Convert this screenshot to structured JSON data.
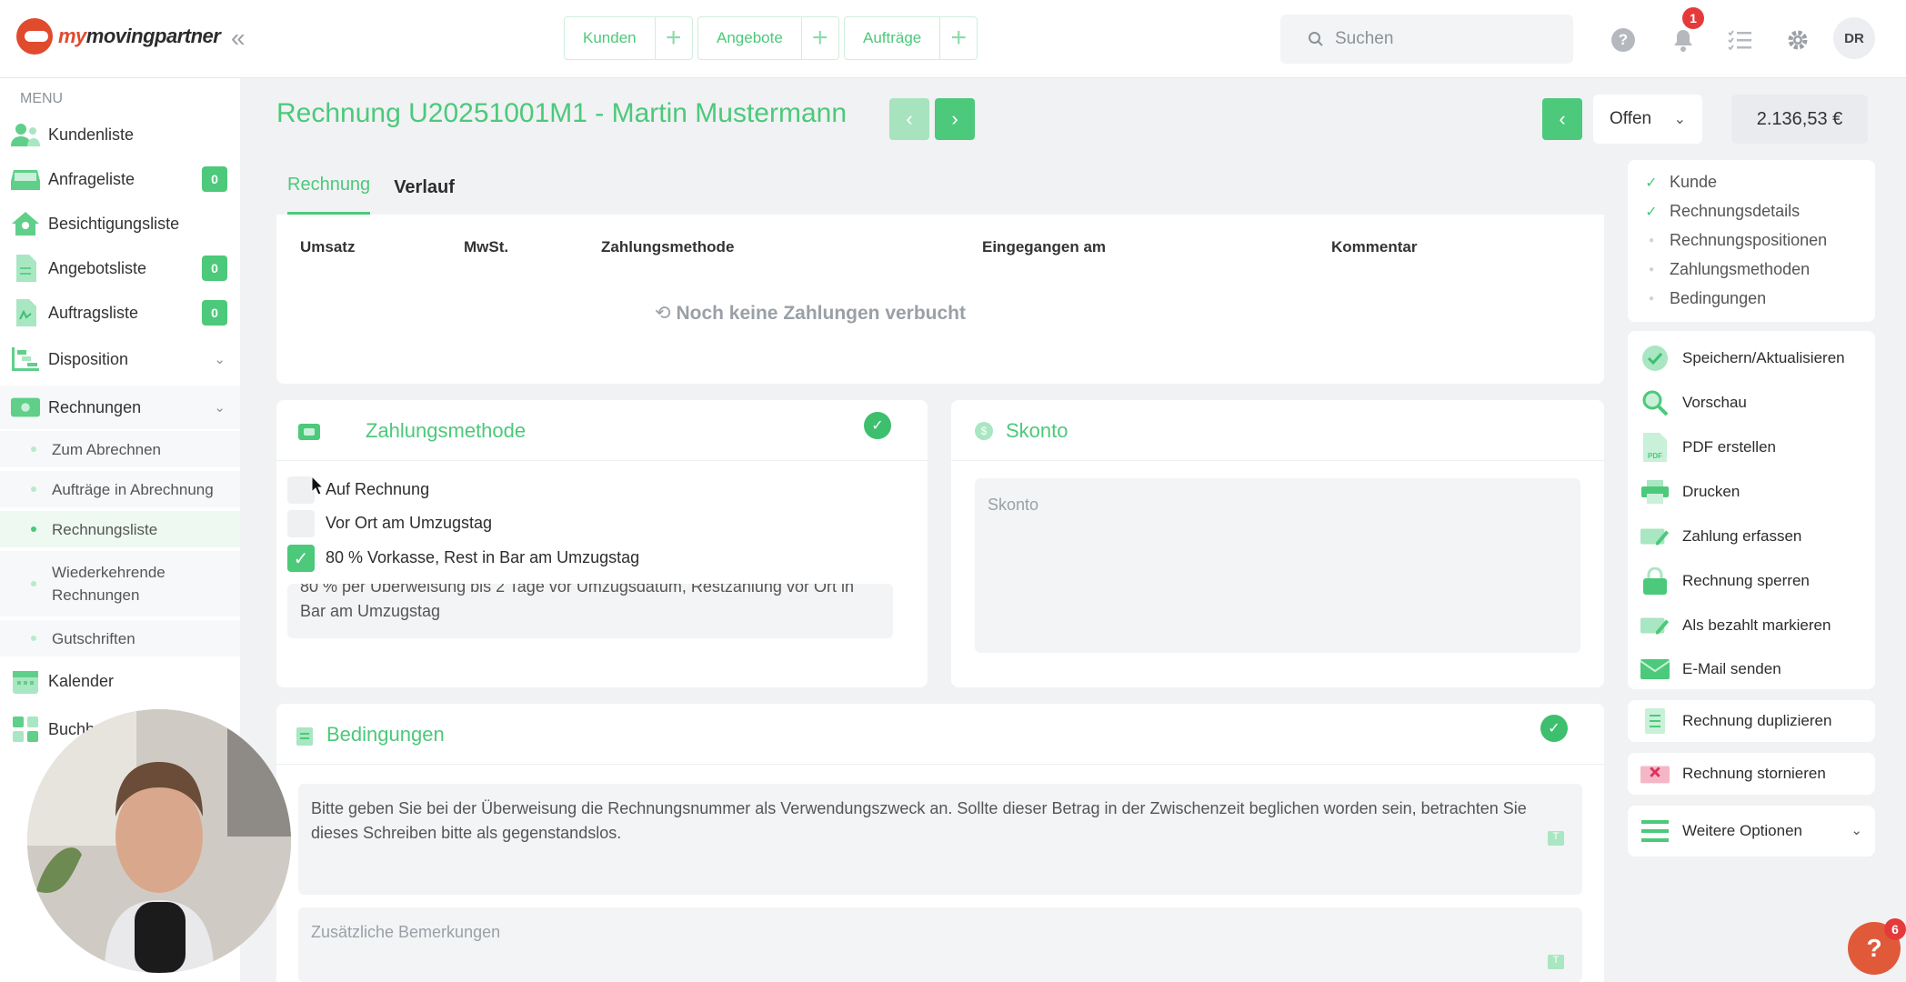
{
  "brand": {
    "logo_text_a": "my",
    "logo_text_b": "movingpartner"
  },
  "header": {
    "quick_actions": [
      {
        "label": "Kunden"
      },
      {
        "label": "Angebote"
      },
      {
        "label": "Aufträge"
      }
    ],
    "search_placeholder": "Suchen",
    "notification_count": "1",
    "avatar_initials": "DR"
  },
  "sidebar": {
    "menu_label": "MENU",
    "items": [
      {
        "label": "Kundenliste"
      },
      {
        "label": "Anfrageliste",
        "count": "0"
      },
      {
        "label": "Besichtigungsliste"
      },
      {
        "label": "Angebotsliste",
        "count": "0"
      },
      {
        "label": "Auftragsliste",
        "count": "0"
      },
      {
        "label": "Disposition"
      },
      {
        "label": "Rechnungen"
      },
      {
        "label": "Kalender"
      },
      {
        "label": "Buchh"
      }
    ],
    "rechnungen_sub": [
      {
        "label": "Zum Abrechnen"
      },
      {
        "label": "Aufträge in Abrechnung"
      },
      {
        "label": "Rechnungsliste"
      },
      {
        "label": "Wiederkehrende Rechnungen"
      },
      {
        "label": "Gutschriften"
      }
    ]
  },
  "invoice": {
    "title": "Rechnung U20251001M1 - Martin Mustermann",
    "status": "Offen",
    "amount": "2.136,53 €"
  },
  "tabs": [
    {
      "label": "Rechnung"
    },
    {
      "label": "Verlauf"
    }
  ],
  "payments_table": {
    "columns": [
      "Umsatz",
      "MwSt.",
      "Zahlungsmethode",
      "Eingegangen am",
      "Kommentar"
    ],
    "empty_text": "Noch keine Zahlungen verbucht"
  },
  "zahlungsmethode": {
    "title": "Zahlungsmethode",
    "options": [
      {
        "label": "Auf Rechnung",
        "checked": false
      },
      {
        "label": "Vor Ort am Umzugstag",
        "checked": false
      },
      {
        "label": "80 % Vorkasse, Rest in Bar am Umzugstag",
        "checked": true
      }
    ],
    "note": "80 % per Überweisung bis 2 Tage vor Umzugsdatum, Restzahlung vor Ort in Bar am Umzugstag"
  },
  "skonto": {
    "title": "Skonto",
    "placeholder": "Skonto"
  },
  "bedingungen": {
    "title": "Bedingungen",
    "text": "Bitte geben Sie bei der Überweisung die Rechnungsnummer als Verwendungszweck an. Sollte dieser Betrag in der Zwischenzeit beglichen worden sein, betrachten Sie dieses Schreiben bitte als gegenstandslos.",
    "remarks_placeholder": "Zusätzliche Bemerkungen"
  },
  "steps": [
    {
      "label": "Kunde",
      "done": true
    },
    {
      "label": "Rechnungsdetails",
      "done": true
    },
    {
      "label": "Rechnungspositionen",
      "done": false
    },
    {
      "label": "Zahlungsmethoden",
      "done": false
    },
    {
      "label": "Bedingungen",
      "done": false
    }
  ],
  "actions": [
    {
      "label": "Speichern/Aktualisieren",
      "icon": "check-circle-icon"
    },
    {
      "label": "Vorschau",
      "icon": "magnifier-icon"
    },
    {
      "label": "PDF erstellen",
      "icon": "pdf-icon"
    },
    {
      "label": "Drucken",
      "icon": "printer-icon"
    },
    {
      "label": "Zahlung erfassen",
      "icon": "money-pen-icon"
    },
    {
      "label": "Rechnung sperren",
      "icon": "lock-icon"
    },
    {
      "label": "Als bezahlt markieren",
      "icon": "money-pen-icon"
    },
    {
      "label": "E-Mail senden",
      "icon": "envelope-icon"
    }
  ],
  "extra_actions": [
    {
      "label": "Rechnung duplizieren"
    },
    {
      "label": "Rechnung stornieren"
    },
    {
      "label": "Weitere Optionen"
    }
  ],
  "help_badge": "6",
  "colors": {
    "accent": "#4cc97a",
    "danger": "#e53a3a",
    "background": "#f1f2f4"
  }
}
